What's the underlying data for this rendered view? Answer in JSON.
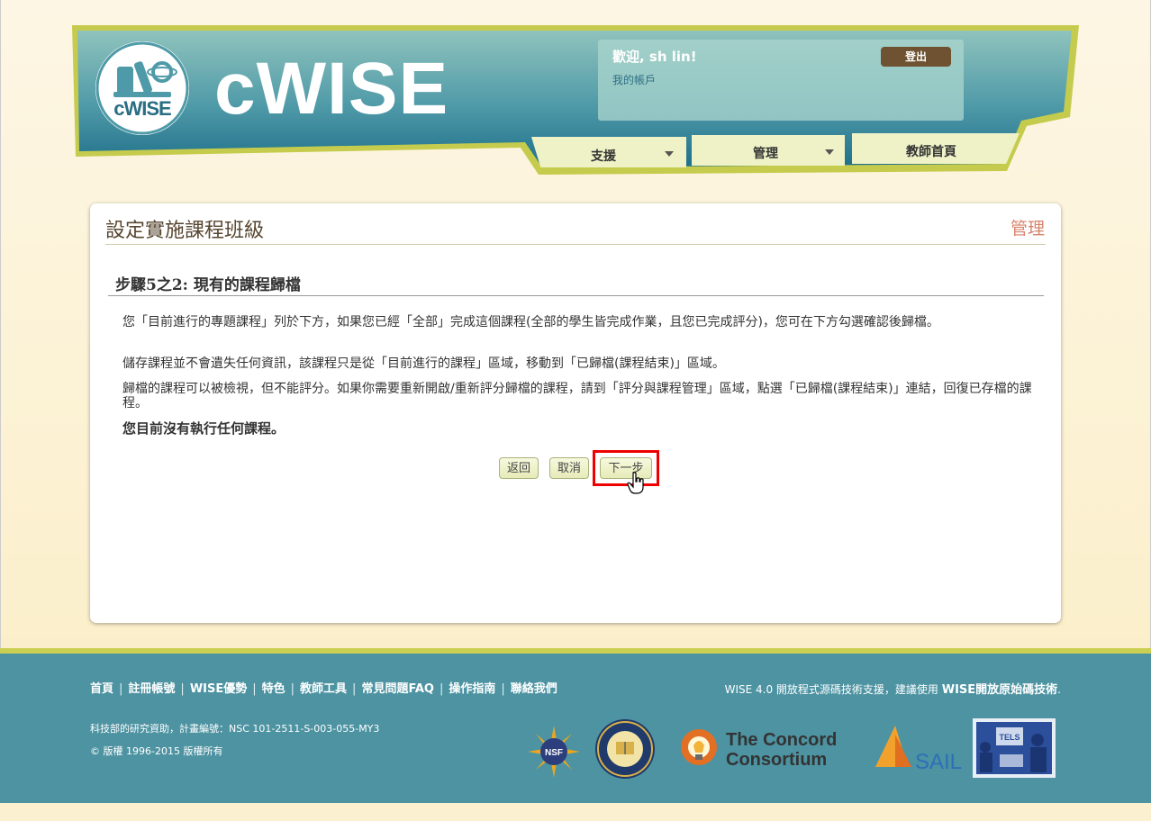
{
  "header": {
    "brand": "cWISE",
    "logo_text": "cWISE",
    "welcome": "歡迎, sh lin!",
    "my_account": "我的帳戶",
    "logout": "登出",
    "nav": {
      "support": "支援",
      "manage": "管理",
      "teacher_home": "教師首頁"
    }
  },
  "panel": {
    "title": "設定實施課程班級",
    "admin_link": "管理",
    "step_title": "步驟5之2: 現有的課程歸檔",
    "paragraphs": [
      "您「目前進行的專題課程」列於下方，如果您已經「全部」完成這個課程(全部的學生皆完成作業，且您已完成評分)，您可在下方勾選確認後歸檔。",
      "儲存課程並不會遺失任何資訊，該課程只是從「目前進行的課程」區域，移動到「已歸檔(課程結束)」區域。",
      "歸檔的課程可以被檢視，但不能評分。如果你需要重新開啟/重新評分歸檔的課程，請到「評分與課程管理」區域，點選「已歸檔(課程結束)」連結，回復已存檔的課程。"
    ],
    "no_projects": "您目前沒有執行任何課程。",
    "buttons": {
      "back": "返回",
      "cancel": "取消",
      "next": "下一步"
    }
  },
  "footer": {
    "links": [
      "首頁",
      "註冊帳號",
      "WISE優勢",
      "特色",
      "教師工具",
      "常見問題FAQ",
      "操作指南",
      "聯絡我們"
    ],
    "credit_prefix": "WISE 4.0 開放程式源碼技術支援，建議使用 ",
    "credit_bold": "WISE開放原始碼技術",
    "credit_suffix": ".",
    "funding": "科技部的研究資助，計畫編號：NSC 101-2511-S-003-055-MY3",
    "copyright": "© 版權 1996-2015 版權所有",
    "partners": {
      "nsf": "NSF",
      "concord_line1": "The Concord",
      "concord_line2": "Consortium",
      "sail": "SAIL",
      "tels": "TELS"
    }
  },
  "colors": {
    "banner_teal": "#2a7f95",
    "banner_border": "#c5cb4c",
    "footer_teal": "#4d93a2",
    "admin_link": "#d7836b",
    "highlight": "#ee0000"
  }
}
